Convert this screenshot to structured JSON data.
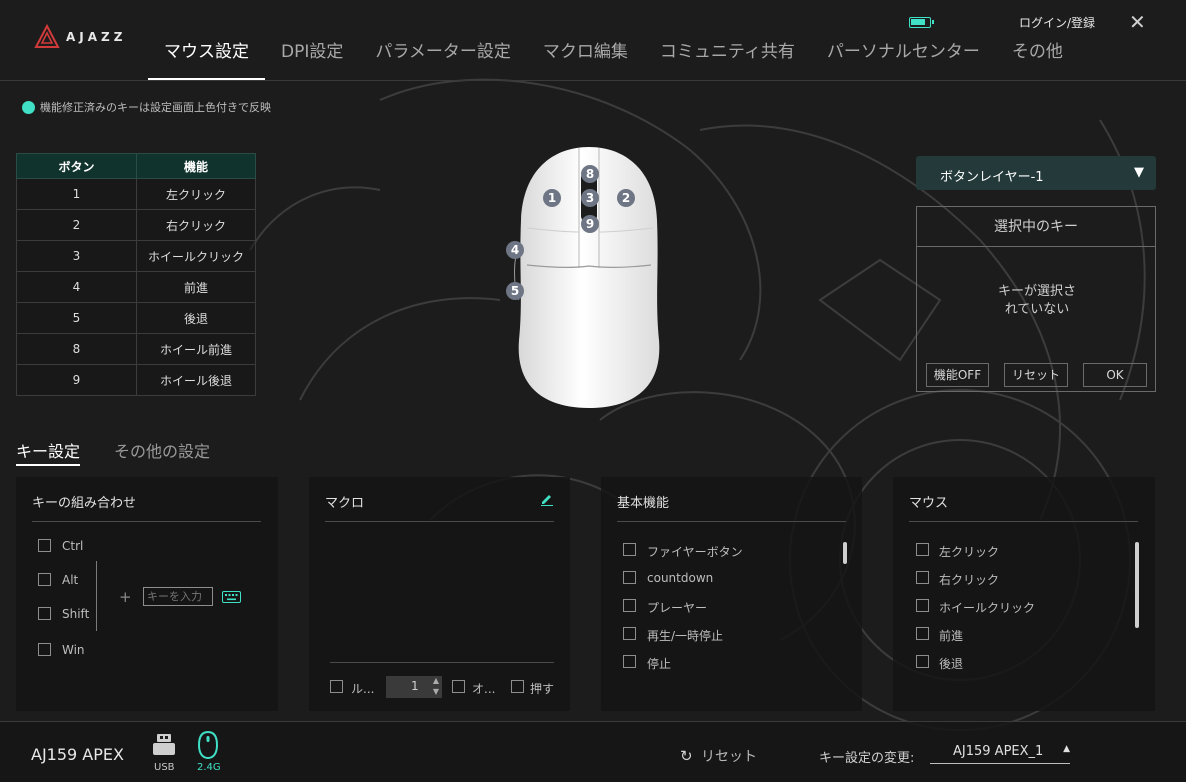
{
  "brand": {
    "logo_text": "AJAZZ"
  },
  "nav": {
    "tabs": [
      {
        "label": "マウス設定",
        "active": true
      },
      {
        "label": "DPI設定"
      },
      {
        "label": "パラメーター設定"
      },
      {
        "label": "マクロ編集"
      },
      {
        "label": "コミュニティ共有"
      },
      {
        "label": "パーソナルセンター"
      },
      {
        "label": "その他"
      }
    ]
  },
  "topbar": {
    "login": "ログイン/登録",
    "battery_level": 0.85,
    "accent": "#3fe0c5"
  },
  "notice": "機能修正済みのキーは設定画面上色付きで反映",
  "button_table": {
    "headers": [
      "ボタン",
      "機能"
    ],
    "rows": [
      [
        "1",
        "左クリック"
      ],
      [
        "2",
        "右クリック"
      ],
      [
        "3",
        "ホイールクリック"
      ],
      [
        "4",
        "前進"
      ],
      [
        "5",
        "後退"
      ],
      [
        "8",
        "ホイール前進"
      ],
      [
        "9",
        "ホイール後退"
      ]
    ]
  },
  "mouse_markers": [
    "8",
    "1",
    "3",
    "2",
    "9",
    "4",
    "5"
  ],
  "layer": {
    "selected": "ボタンレイヤー-1",
    "arrow": "▼"
  },
  "selected_key": {
    "title": "選択中のキー",
    "empty_line1": "キーが選択さ",
    "empty_line2": "れていない",
    "btn_off": "機能OFF",
    "btn_reset": "リセット",
    "btn_ok": "OK"
  },
  "subtabs": {
    "key": "キー設定",
    "other": "その他の設定"
  },
  "combo": {
    "title": "キーの組み合わせ",
    "modifiers": [
      "Ctrl",
      "Alt",
      "Shift",
      "Win"
    ],
    "plus": "+",
    "input_placeholder": "キーを入力"
  },
  "macro": {
    "title": "マクロ",
    "loop_label": "ル...",
    "count": "1",
    "other_label": "オ...",
    "press_label": "押す"
  },
  "basic": {
    "title": "基本機能",
    "items": [
      "ファイヤーボタン",
      "countdown",
      "プレーヤー",
      "再生/一時停止",
      "停止"
    ]
  },
  "mouse_funcs": {
    "title": "マウス",
    "items": [
      "左クリック",
      "右クリック",
      "ホイールクリック",
      "前進",
      "後退"
    ]
  },
  "footer": {
    "device": "AJ159 APEX",
    "usb": "USB",
    "wireless": "2.4G",
    "reset": "リセット",
    "profile_label": "キー設定の変更:",
    "profile_value": "AJ159 APEX_1"
  }
}
